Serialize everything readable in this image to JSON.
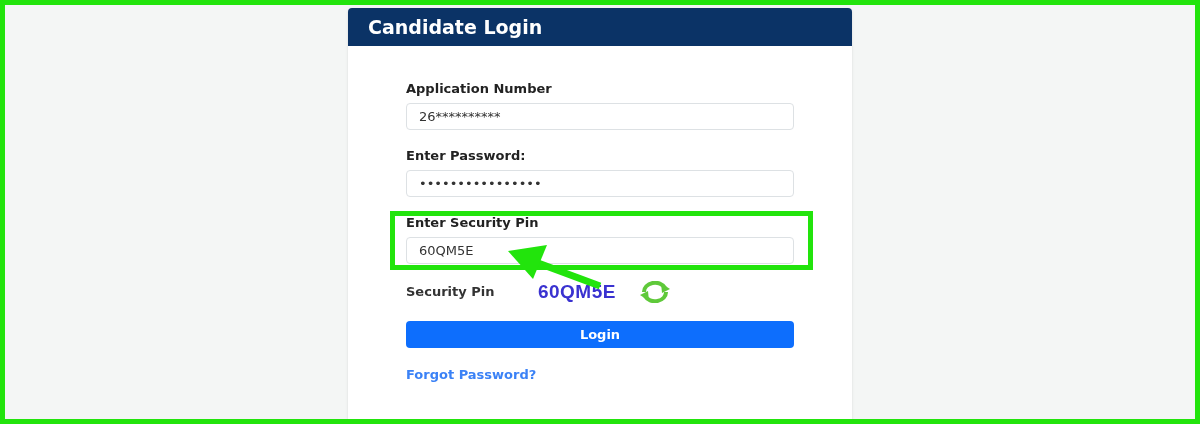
{
  "card": {
    "title": "Candidate Login"
  },
  "fields": [
    {
      "label": "Application Number",
      "value": "26**********"
    },
    {
      "label": "Enter Password:",
      "value": "••••••••••••••••"
    },
    {
      "label": "Enter Security Pin",
      "value": "60QM5E"
    }
  ],
  "security_pin": {
    "label": "Security Pin",
    "code": "60QM5E"
  },
  "login_button": "Login",
  "forgot_link": "Forgot Password?"
}
